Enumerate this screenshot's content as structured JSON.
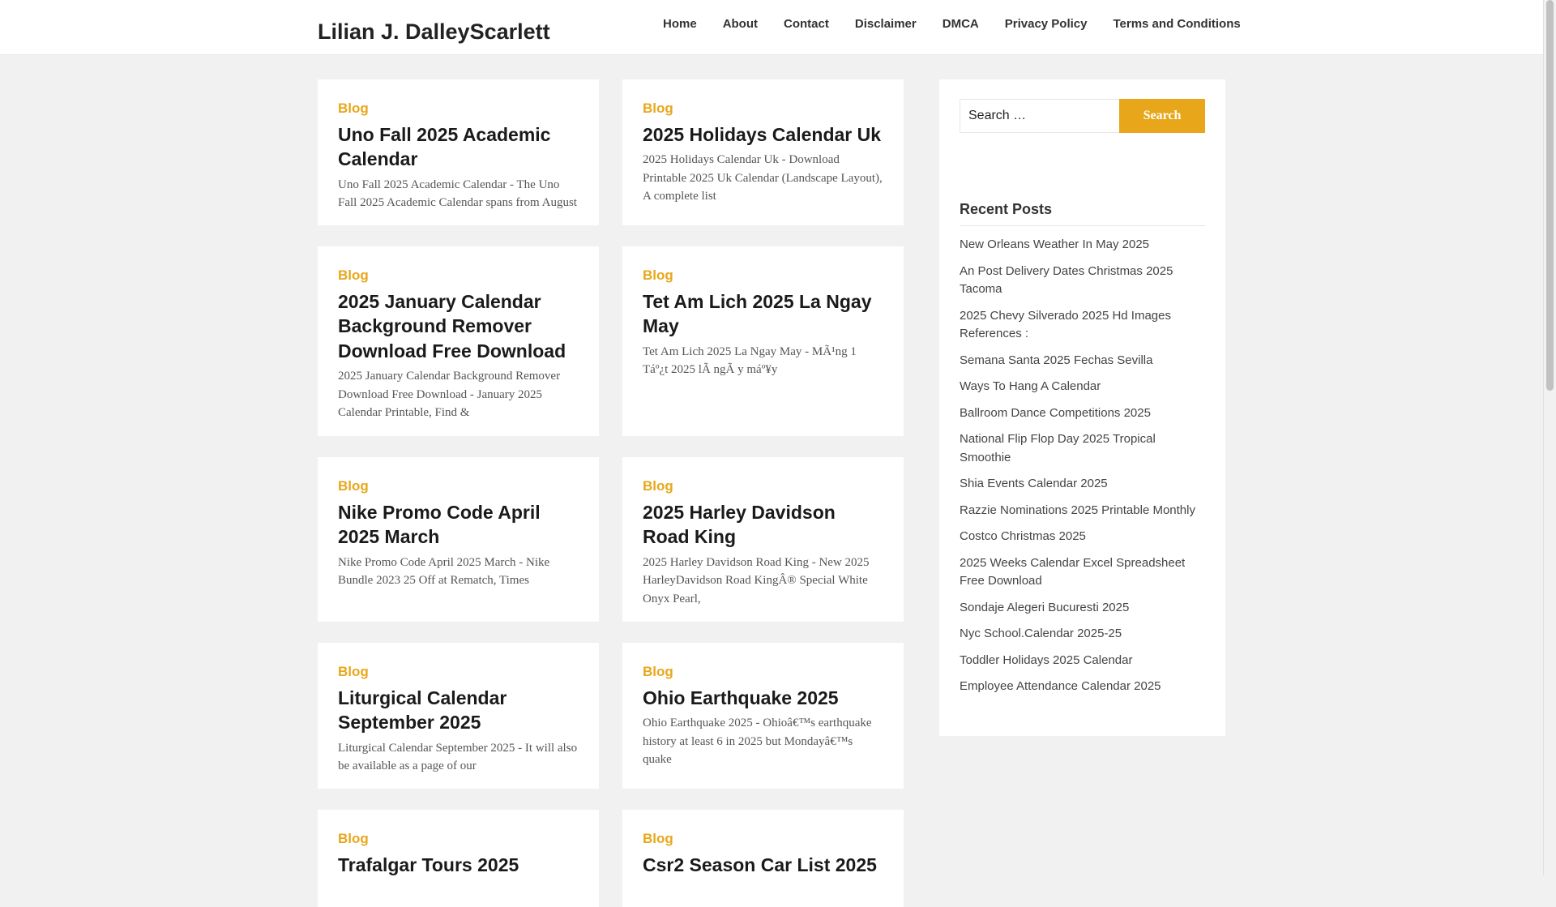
{
  "site": {
    "title": "Lilian J. DalleyScarlett"
  },
  "nav": [
    "Home",
    "About",
    "Contact",
    "Disclaimer",
    "DMCA",
    "Privacy Policy",
    "Terms and Conditions"
  ],
  "posts": [
    {
      "category": "Blog",
      "title": "Uno Fall 2025 Academic Calendar",
      "excerpt": "Uno Fall 2025 Academic Calendar - The Uno Fall 2025 Academic Calendar spans from August"
    },
    {
      "category": "Blog",
      "title": "2025 Holidays Calendar Uk",
      "excerpt": "2025 Holidays Calendar Uk - Download Printable 2025 Uk Calendar (Landscape Layout), A complete list"
    },
    {
      "category": "Blog",
      "title": "2025 January Calendar Background Remover Download Free Download",
      "excerpt": "2025 January Calendar Background Remover Download Free Download - January 2025 Calendar Printable, Find &"
    },
    {
      "category": "Blog",
      "title": "Tet Am Lich 2025 La Ngay May",
      "excerpt": "Tet Am Lich 2025 La Ngay May - MÃ¹ng 1 Táº¿t 2025 lÃ  ngÃ y máº¥y"
    },
    {
      "category": "Blog",
      "title": "Nike Promo Code April 2025 March",
      "excerpt": "Nike Promo Code April 2025 March - Nike Bundle 2023 25 Off at Rematch, Times"
    },
    {
      "category": "Blog",
      "title": "2025 Harley Davidson Road King",
      "excerpt": "2025 Harley Davidson Road King - New 2025 HarleyDavidson Road KingÂ® Special White Onyx Pearl,"
    },
    {
      "category": "Blog",
      "title": "Liturgical Calendar September 2025",
      "excerpt": "Liturgical Calendar September 2025 - It will also be available as a page of our"
    },
    {
      "category": "Blog",
      "title": "Ohio Earthquake 2025",
      "excerpt": "Ohio Earthquake 2025 - Ohioâ€™s earthquake history at least 6 in 2025 but Mondayâ€™s quake"
    },
    {
      "category": "Blog",
      "title": "Trafalgar Tours 2025",
      "excerpt": ""
    },
    {
      "category": "Blog",
      "title": "Csr2 Season Car List 2025",
      "excerpt": ""
    }
  ],
  "sidebar": {
    "search": {
      "placeholder": "Search …",
      "button": "Search"
    },
    "recent_heading": "Recent Posts",
    "recent_posts": [
      "New Orleans Weather In May 2025",
      "An Post Delivery Dates Christmas 2025 Tacoma",
      "2025 Chevy Silverado 2025 Hd Images References :",
      "Semana Santa 2025 Fechas Sevilla",
      "Ways To Hang A Calendar",
      "Ballroom Dance Competitions 2025",
      "National Flip Flop Day 2025 Tropical Smoothie",
      "Shia Events Calendar 2025",
      "Razzie Nominations 2025 Printable Monthly",
      "Costco Christmas 2025",
      "2025 Weeks Calendar Excel Spreadsheet Free Download",
      "Sondaje Alegeri Bucuresti 2025",
      "Nyc School.Calendar 2025-25",
      "Toddler Holidays 2025 Calendar",
      "Employee Attendance Calendar 2025"
    ]
  },
  "colors": {
    "accent": "#e8a71a",
    "background": "#f1f1f1",
    "card": "#ffffff"
  }
}
